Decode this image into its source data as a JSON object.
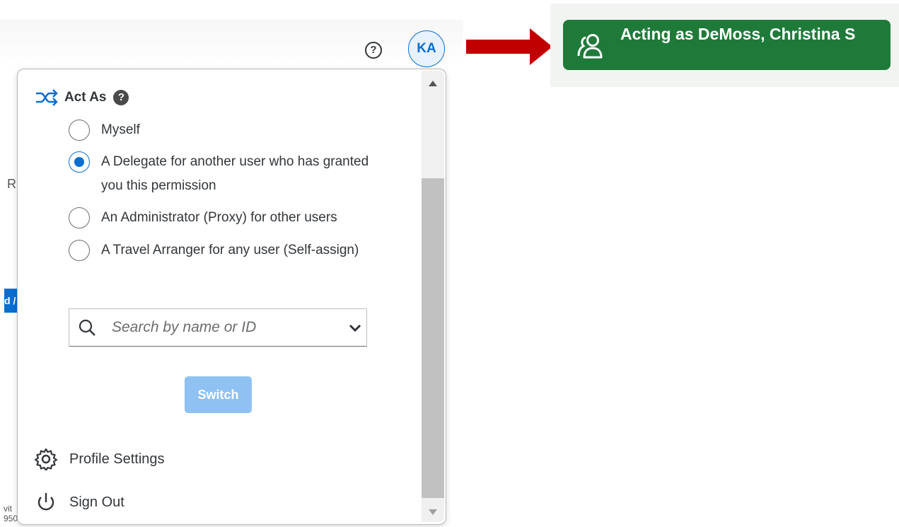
{
  "background": {
    "fragment_left": "R",
    "fragment_blue": "d /",
    "fragment_bottom_1": "vit",
    "fragment_bottom_2": "950"
  },
  "header": {
    "help_icon_glyph": "?",
    "avatar_initials": "KA"
  },
  "act_as": {
    "title": "Act As",
    "help_glyph": "?",
    "options": [
      {
        "label": "Myself",
        "checked": false
      },
      {
        "label": "A Delegate for another user who has granted you this permission",
        "checked": true
      },
      {
        "label": "An Administrator (Proxy) for other users",
        "checked": false
      },
      {
        "label": "A Travel Arranger for any user (Self-assign)",
        "checked": false
      }
    ],
    "search": {
      "placeholder": "Search by name or ID",
      "value": ""
    },
    "switch_label": "Switch"
  },
  "menu": {
    "profile_settings": "Profile Settings",
    "sign_out": "Sign Out"
  },
  "acting_badge": {
    "text": "Acting as DeMoss, Christina S"
  },
  "colors": {
    "accent": "#0a6ed1",
    "switch_disabled": "#8fc2f2",
    "badge_green": "#1f7a3a",
    "arrow_red": "#c00000"
  },
  "icons": {
    "act_as": "shuffle-icon",
    "search": "search-icon",
    "dropdown": "chevron-down-icon",
    "profile": "gear-icon",
    "signout": "power-icon",
    "badge": "people-icon",
    "pointer": "right-arrow-icon"
  }
}
